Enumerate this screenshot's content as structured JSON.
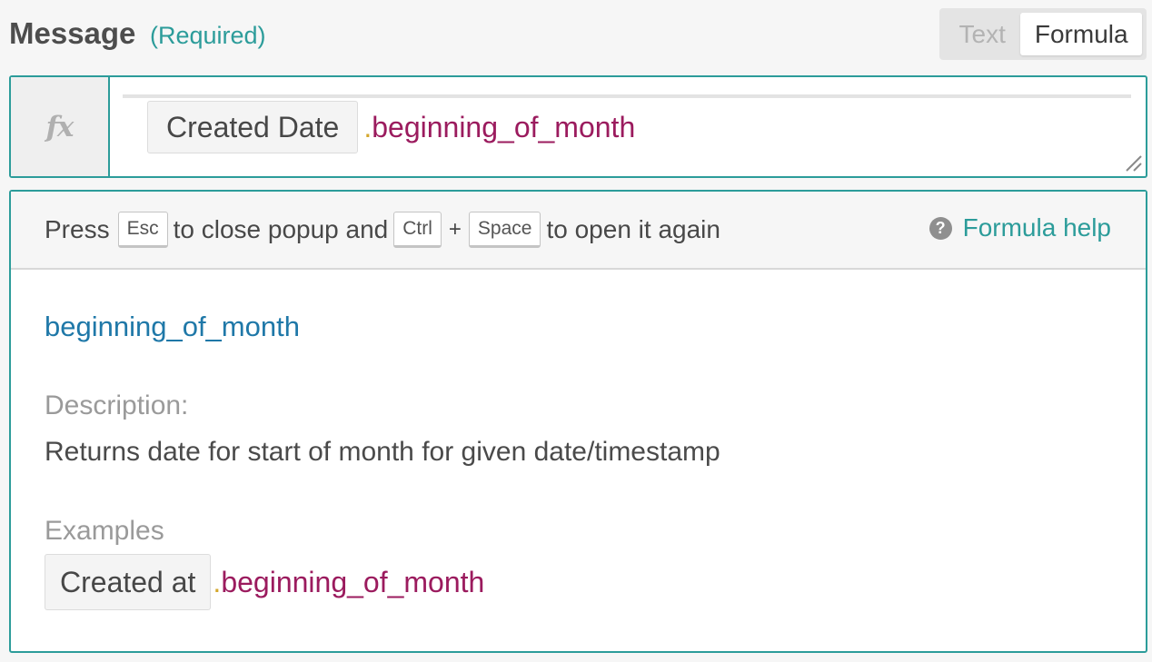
{
  "field": {
    "label": "Message",
    "required": "(Required)"
  },
  "mode_toggle": {
    "text_label": "Text",
    "formula_label": "Formula",
    "selected": "Formula"
  },
  "formula": {
    "token": "Created Date",
    "dot": ".",
    "method": "beginning_of_month"
  },
  "popup": {
    "hint": {
      "press": "Press",
      "esc_key": "Esc",
      "close_text": "to close popup and",
      "ctrl_key": "Ctrl",
      "plus": "+",
      "space_key": "Space",
      "open_text": "to open it again"
    },
    "help_label": "Formula help",
    "function_name": "beginning_of_month",
    "description_label": "Description:",
    "description": "Returns date for start of month for given date/timestamp",
    "examples_label": "Examples",
    "example": {
      "token": "Created at",
      "dot": ".",
      "method": "beginning_of_month"
    }
  },
  "colors": {
    "accent": "#2c9c9a",
    "method": "#9b1b5e",
    "function_name": "#1f78a8",
    "dot": "#d4a72c"
  },
  "icons": {
    "formula_gutter": "fx-icon",
    "help": "question-circle-icon",
    "resize": "resize-handle-icon"
  }
}
